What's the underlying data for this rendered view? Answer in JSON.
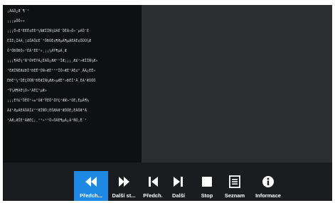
{
  "text_lines": [
    "¡Á&Ô¿Æ´¶´¹",
    "¡¡¡µÖÖ»÷",
    "¡¡¡Ö»È¹ÈÈÊ¢ÉÈ²¼ÑÆÏÎÑ¼ÙÁÉ¨ÖÊÁ»Ö»¨µÁÖ¨È",
    "ÉÎÈ¡ÎÁÁ¸|£ÖÁÖ£É´²ÖÐÙÉ¢¶ÆµÁ¶µÀÈÁÉ¢ÖÜÙ¾Æ",
    "Ö°ÔÐÖÐÔ»¹ÈÁ¹ÈÈ²»¸¡¡¼ÁÝ¶µÁ¸Æ",
    "¡¡¡¶ÃÉ¼²Ñ¹Õ¥ÉÝÁ¿ÈÁÖ¿ÆÆ¹¹ÏÆ¡¡¡¸Æ£¹»ÆÎÎÑ¼Æ»",
    "¹ÈÆÎÑÈÆ£ÐÎ¹ÐÈË¹ÕÑ»ÆÈ¹¹²ÎÖ»ÆÉ¹ÀÈ¢²¸ÂÃ¿ÈÊ»",
    "ÈÐÈ¹¼²ÜÈÇÖÜÑ¹ÐÉÆÎÑ¼ÆÆ»µÆÈ²»ÐÉÎ¹Â¸ÈÁ¹ÆÙÖÖ",
    "¹Ý¼Æ¶ÀÈ¼Õ»¹ÀÈÇ°µÆ»",
    "¡¡¡ÈÝ£²ÖÈÔ¹»±²ÚÆ¹ÝÉÖ¹ÔÝÇ¹ÆÆ»¹ÚÉ¡ÈµÀ¶½",
    "À£¹ÆµÁÈÁÔÁÎ£²²ÆÎÑÖ¦ÉÔÆÁÆ¹ÆÔÛÉ¡ÈÀÔÆ³Á",
    "¹ÀÆ¡ÆÎÈ¹ÀÆÉÇ¡¸¹¹»¹¹Ö»ÔÁÉ¶µÁ¿Á¹ÑÛ¡Ê´¹"
  ],
  "toolbar": {
    "buttons": [
      {
        "id": "prev",
        "label": "Předch...",
        "icon": "rewind-icon",
        "active": true
      },
      {
        "id": "next-st",
        "label": "Další st...",
        "icon": "fast-forward-icon",
        "active": false
      },
      {
        "id": "prev2",
        "label": "Předch.",
        "icon": "skip-previous-icon",
        "active": false
      },
      {
        "id": "next",
        "label": "Další",
        "icon": "skip-next-icon",
        "active": false
      },
      {
        "id": "stop",
        "label": "Stop",
        "icon": "stop-icon",
        "active": false
      },
      {
        "id": "list",
        "label": "Seznam",
        "icon": "list-icon",
        "active": false
      },
      {
        "id": "info",
        "label": "Informace",
        "icon": "info-icon",
        "active": false
      }
    ]
  },
  "colors": {
    "accent": "#1e88e5",
    "toolbar_bg": "#1b1c1f",
    "panel_bg": "#0f1012",
    "viewer_bg": "#2b2d31"
  }
}
